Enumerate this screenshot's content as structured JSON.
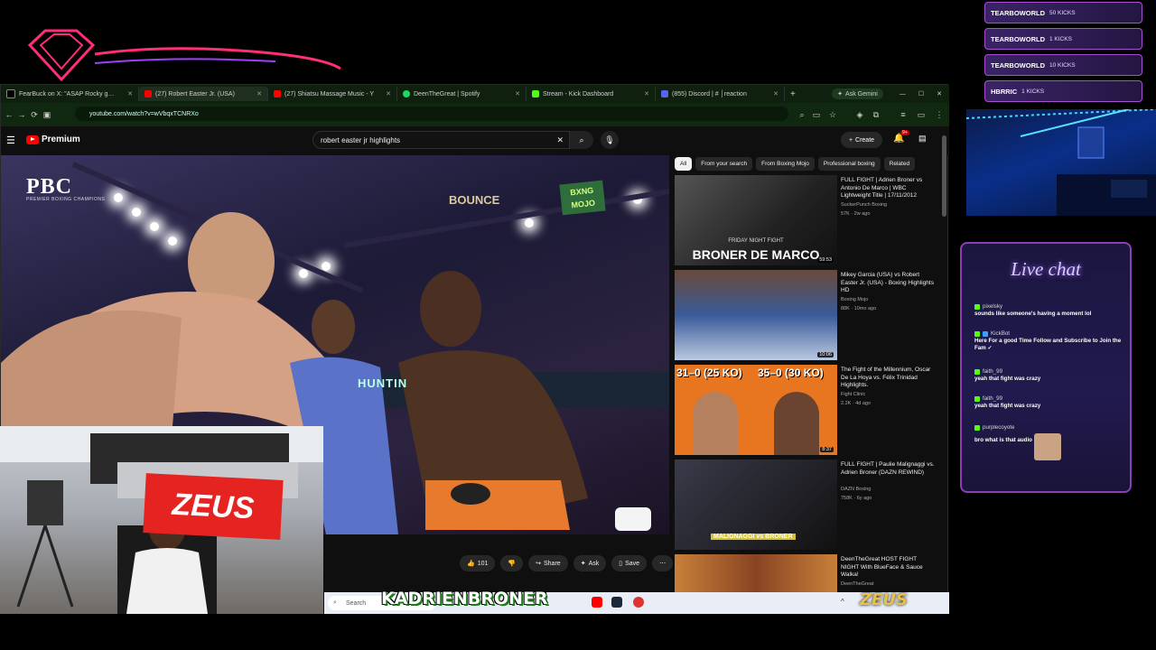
{
  "overlay": {
    "kicks": [
      {
        "name": "TEARBOWORLD",
        "count": "50 KICKS"
      },
      {
        "name": "TEARBOWORLD",
        "count": "1 KICKS"
      },
      {
        "name": "TEARBOWORLD",
        "count": "10 KICKS"
      },
      {
        "name": "HBRRIC",
        "count": "1 KICKS"
      }
    ],
    "streamer_name": "KADRIENBRONER",
    "sponsor": "ZEUS"
  },
  "browser": {
    "tabs": [
      {
        "label": "FearBuck on X: \"ASAP Rocky g…",
        "icon_color": "#ffffff"
      },
      {
        "label": "(27) Robert Easter Jr. (USA)",
        "icon_color": "#ff0000"
      },
      {
        "label": "(27) Shiatsu Massage Music - Y",
        "icon_color": "#ff0000"
      },
      {
        "label": "DeenTheGreat | Spotify",
        "icon_color": "#1ed760"
      },
      {
        "label": "Stream - Kick Dashboard",
        "icon_color": "#53fc18"
      },
      {
        "label": "(855) Discord | # │reaction",
        "icon_color": "#5865f2"
      }
    ],
    "ask_gemini": "Ask Gemini",
    "url": "youtube.com/watch?v=wVbqxTCNRXo"
  },
  "youtube": {
    "brand": "Premium",
    "search_value": "robert easter jr highlights",
    "create_label": "Create",
    "notif_count": "9+",
    "chips": [
      "All",
      "From your search",
      "From Boxing Mojo",
      "Professional boxing",
      "Related"
    ],
    "video": {
      "pbc_logo": "PBC",
      "pbc_sub": "PREMIER BOXING CHAMPIONS",
      "bounce": "BOUNCE",
      "mojo": "BXNG MOJO",
      "banner": "HUNTIN",
      "likes": "101",
      "share": "Share",
      "ask": "Ask",
      "save": "Save"
    },
    "recommendations": [
      {
        "title": "FULL FIGHT | Adrien Broner vs Antonio De Marco | WBC Lightweight Title | 17/11/2012",
        "channel": "SuckerPunch Boxing",
        "meta": "57K · 2w ago",
        "duration": "59:53",
        "thumb_text": "BRONER DE MARCO",
        "thumb_sub": "FRIDAY NIGHT FIGHT"
      },
      {
        "title": "Mikey Garcia (USA) vs Robert Easter Jr. (USA) - Boxing Highlights HD",
        "channel": "Boxing Mojo",
        "meta": "88K · 10mo ago",
        "duration": "10:06",
        "thumb_text": "",
        "thumb_sub": ""
      },
      {
        "title": "The Fight of the Millennium, Oscar De La Hoya vs. Félix Trinidad Highlights.",
        "channel": "Fight Clinic",
        "meta": "2.2K · 4d ago",
        "duration": "8:37",
        "thumb_text": "31–0 (25 KO)",
        "thumb_sub": "35–0 (30 KO)"
      },
      {
        "title": "FULL FIGHT | Paulie Malignaggi vs. Adrien Broner (DAZN REWIND)",
        "channel": "DAZN Boxing",
        "meta": "758K · 6y ago",
        "duration": "",
        "thumb_text": "MALIGNAGGI vs BRONER",
        "thumb_sub": ""
      },
      {
        "title": "DeenTheGreat HOST FIGHT NIGHT With BlueFace & Sauce Walka!",
        "channel": "DeenTheGreat",
        "meta": "",
        "duration": "",
        "thumb_text": "",
        "thumb_sub": ""
      }
    ]
  },
  "taskbar": {
    "search_placeholder": "Search"
  },
  "chat": {
    "title": "Live chat",
    "messages": [
      {
        "user": "pixelsky",
        "text": "sounds like someone's having a moment lol"
      },
      {
        "user": "KickBot",
        "text": "Here For a good Time Follow and Subscribe to Join the Fam ✓"
      },
      {
        "user": "faith_99",
        "text": "yeah that fight was crazy"
      },
      {
        "user": "faith_99",
        "text": "yeah that fight was crazy"
      },
      {
        "user": "purplecoyote",
        "text": "bro what is that audio"
      }
    ]
  },
  "colors": {
    "accent": "#53fc18",
    "youtube_red": "#ff0000",
    "overlay_purple": "#a84fd1"
  }
}
